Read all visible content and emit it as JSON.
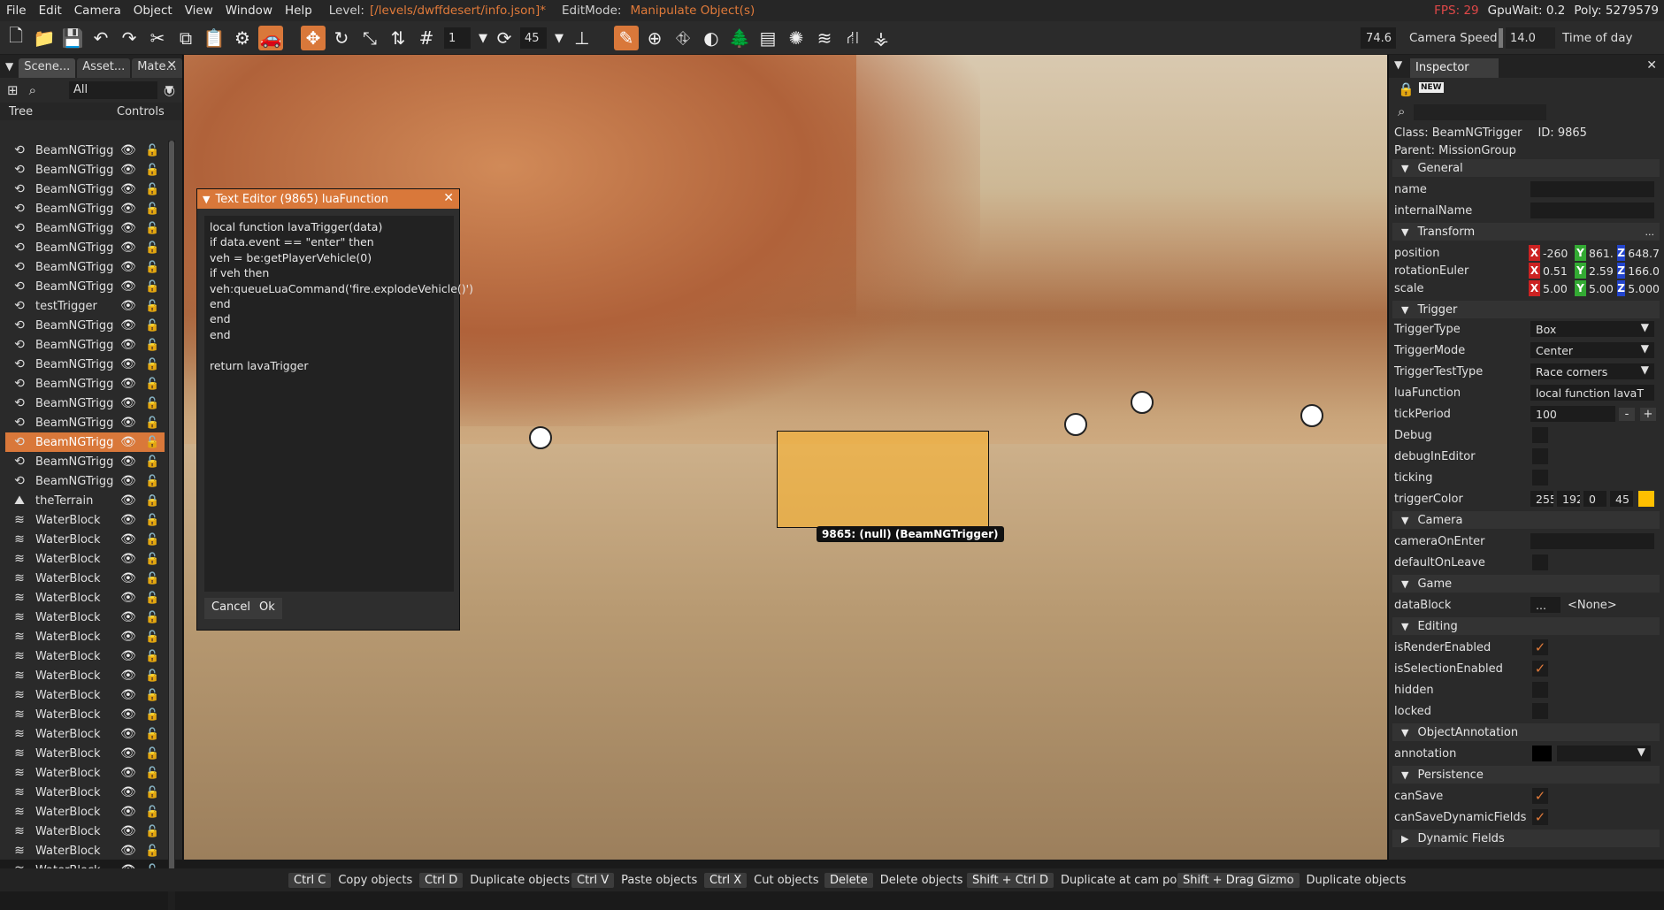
{
  "menu": {
    "items": [
      "File",
      "Edit",
      "Camera",
      "Object",
      "View",
      "Window",
      "Help"
    ],
    "level_label": "Level:",
    "level_path": "[/levels/dwffdesert/info.json]*",
    "editmode_label": "EditMode:",
    "editmode_value": "Manipulate Object(s)",
    "fps": "FPS: 29",
    "gpuwait": "GpuWait: 0.2",
    "poly": "Poly: 5279579"
  },
  "toolbar": {
    "snap_value": "1",
    "rotate_value": "45",
    "fov": "74.6",
    "camera_speed_label": "Camera Speed",
    "camera_speed": "14.0",
    "time_of_day_label": "Time of day"
  },
  "left": {
    "tabs": [
      "Scene...",
      "Asset...",
      "Mate..."
    ],
    "filter": "All",
    "col_tree": "Tree",
    "col_controls": "Controls",
    "tree": [
      {
        "name": "BeamNGTrigg",
        "icon": "trigger-icon"
      },
      {
        "name": "BeamNGTrigg",
        "icon": "trigger-icon"
      },
      {
        "name": "BeamNGTrigg",
        "icon": "trigger-icon"
      },
      {
        "name": "BeamNGTrigg",
        "icon": "trigger-icon"
      },
      {
        "name": "BeamNGTrigg",
        "icon": "trigger-icon"
      },
      {
        "name": "BeamNGTrigg",
        "icon": "trigger-icon"
      },
      {
        "name": "BeamNGTrigg",
        "icon": "trigger-icon"
      },
      {
        "name": "BeamNGTrigg",
        "icon": "trigger-icon"
      },
      {
        "name": "testTrigger",
        "icon": "trigger-icon"
      },
      {
        "name": "BeamNGTrigg",
        "icon": "trigger-icon"
      },
      {
        "name": "BeamNGTrigg",
        "icon": "trigger-icon"
      },
      {
        "name": "BeamNGTrigg",
        "icon": "trigger-icon"
      },
      {
        "name": "BeamNGTrigg",
        "icon": "trigger-icon"
      },
      {
        "name": "BeamNGTrigg",
        "icon": "trigger-icon"
      },
      {
        "name": "BeamNGTrigg",
        "icon": "trigger-icon"
      },
      {
        "name": "BeamNGTrigg",
        "icon": "trigger-icon",
        "selected": true
      },
      {
        "name": "BeamNGTrigg",
        "icon": "trigger-icon"
      },
      {
        "name": "BeamNGTrigg",
        "icon": "trigger-icon"
      },
      {
        "name": "theTerrain",
        "icon": "terrain-icon",
        "locked": true
      },
      {
        "name": "WaterBlock",
        "icon": "water-icon"
      },
      {
        "name": "WaterBlock",
        "icon": "water-icon"
      },
      {
        "name": "WaterBlock",
        "icon": "water-icon"
      },
      {
        "name": "WaterBlock",
        "icon": "water-icon"
      },
      {
        "name": "WaterBlock",
        "icon": "water-icon"
      },
      {
        "name": "WaterBlock",
        "icon": "water-icon"
      },
      {
        "name": "WaterBlock",
        "icon": "water-icon"
      },
      {
        "name": "WaterBlock",
        "icon": "water-icon"
      },
      {
        "name": "WaterBlock",
        "icon": "water-icon"
      },
      {
        "name": "WaterBlock",
        "icon": "water-icon"
      },
      {
        "name": "WaterBlock",
        "icon": "water-icon"
      },
      {
        "name": "WaterBlock",
        "icon": "water-icon"
      },
      {
        "name": "WaterBlock",
        "icon": "water-icon"
      },
      {
        "name": "WaterBlock",
        "icon": "water-icon"
      },
      {
        "name": "WaterBlock",
        "icon": "water-icon"
      },
      {
        "name": "WaterBlock",
        "icon": "water-icon"
      },
      {
        "name": "WaterBlock",
        "icon": "water-icon"
      },
      {
        "name": "WaterBlock",
        "icon": "water-icon"
      },
      {
        "name": "WaterBlock",
        "icon": "water-icon"
      }
    ]
  },
  "viewport": {
    "trigger_tag": "9865: (null) (BeamNGTrigger)"
  },
  "text_editor": {
    "title": "Text Editor (9865) luaFunction",
    "code": "local function lavaTrigger(data)\nif data.event == \"enter\" then\nveh = be:getPlayerVehicle(0)\nif veh then\nveh:queueLuaCommand('fire.explodeVehicle()')\nend\nend\nend\n\nreturn lavaTrigger",
    "cancel": "Cancel",
    "ok": "Ok"
  },
  "inspector": {
    "tab": "Inspector",
    "class_label": "Class:",
    "class": "BeamNGTrigger",
    "id_label": "ID:",
    "id": "9865",
    "parent_label": "Parent:",
    "parent": "MissionGroup",
    "sections": {
      "general": "General",
      "transform": "Transform",
      "trigger": "Trigger",
      "camera": "Camera",
      "game": "Game",
      "editing": "Editing",
      "annotation": "ObjectAnnotation",
      "persistence": "Persistence",
      "dynamic": "Dynamic Fields"
    },
    "fields": {
      "name": "name",
      "internalName": "internalName",
      "position": "position",
      "position_x": "-260",
      "position_y": "861.",
      "position_z": "648.7",
      "rotationEuler": "rotationEuler",
      "rot_x": "0.51",
      "rot_y": "2.59",
      "rot_z": "166.0",
      "scale": "scale",
      "scale_x": "5.00",
      "scale_y": "5.00",
      "scale_z": "5.000",
      "triggerType": "TriggerType",
      "triggerType_value": "Box",
      "triggerMode": "TriggerMode",
      "triggerMode_value": "Center",
      "triggerTestType": "TriggerTestType",
      "triggerTestType_value": "Race corners",
      "luaFunction": "luaFunction",
      "luaFunction_value": "local function lavaT",
      "tickPeriod": "tickPeriod",
      "tickPeriod_value": "100",
      "debug": "Debug",
      "debugInEditor": "debugInEditor",
      "ticking": "ticking",
      "triggerColor": "triggerColor",
      "color_r": "255",
      "color_g": "192",
      "color_b": "0",
      "color_a": "45",
      "cameraOnEnter": "cameraOnEnter",
      "defaultOnLeave": "defaultOnLeave",
      "dataBlock": "dataBlock",
      "dataBlock_btn": "...",
      "dataBlock_value": "<None>",
      "isRenderEnabled": "isRenderEnabled",
      "isSelectionEnabled": "isSelectionEnabled",
      "hidden": "hidden",
      "locked": "locked",
      "annotation": "annotation",
      "canSave": "canSave",
      "canSaveDynamicFields": "canSaveDynamicFields"
    },
    "colors": {
      "accent": "#d9783a",
      "triggerColor": "#ffc000"
    }
  },
  "statusbar": [
    {
      "key": "Ctrl C",
      "desc": "Copy objects"
    },
    {
      "key": "Ctrl D",
      "desc": "Duplicate objects"
    },
    {
      "key": "Ctrl V",
      "desc": "Paste objects"
    },
    {
      "key": "Ctrl X",
      "desc": "Cut objects"
    },
    {
      "key": "Delete",
      "desc": "Delete objects"
    },
    {
      "key": "Shift + Ctrl D",
      "desc": "Duplicate at cam pos"
    },
    {
      "key": "Shift + Drag Gizmo",
      "desc": "Duplicate objects"
    }
  ]
}
